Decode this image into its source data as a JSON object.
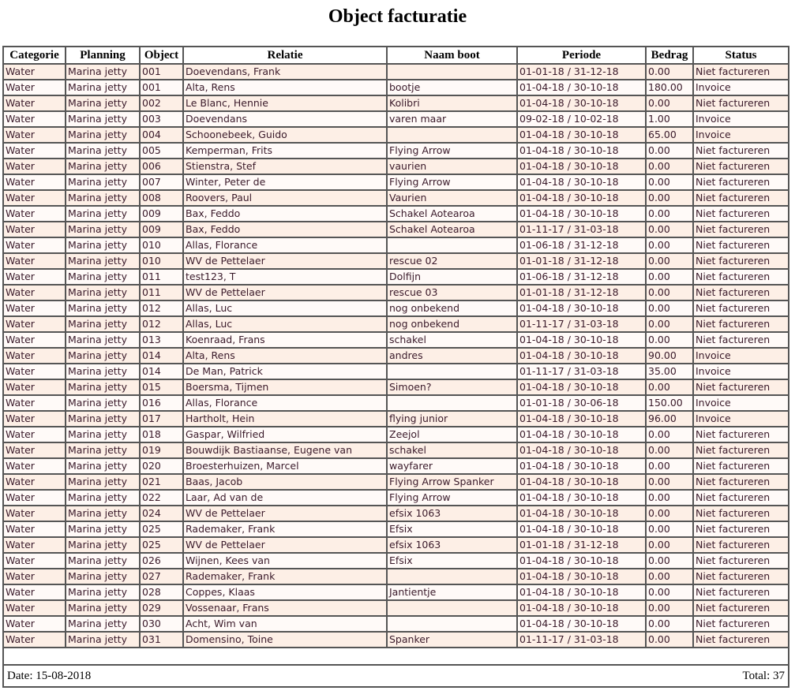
{
  "title": "Object facturatie",
  "columns": [
    "Categorie",
    "Planning",
    "Object",
    "Relatie",
    "Naam boot",
    "Periode",
    "Bedrag",
    "Status"
  ],
  "rows": [
    [
      "Water",
      "Marina jetty",
      "001",
      "Doevendans, Frank",
      "",
      "01-01-18 / 31-12-18",
      "0.00",
      "Niet factureren"
    ],
    [
      "Water",
      "Marina jetty",
      "001",
      "Alta, Rens",
      "bootje",
      "01-04-18 / 30-10-18",
      "180.00",
      "Invoice"
    ],
    [
      "Water",
      "Marina jetty",
      "002",
      "Le Blanc, Hennie",
      "Kolibri",
      "01-04-18 / 30-10-18",
      "0.00",
      "Niet factureren"
    ],
    [
      "Water",
      "Marina jetty",
      "003",
      "Doevendans",
      "varen maar",
      "09-02-18 / 10-02-18",
      "1.00",
      "Invoice"
    ],
    [
      "Water",
      "Marina jetty",
      "004",
      "Schoonebeek, Guido",
      "",
      "01-04-18 / 30-10-18",
      "65.00",
      "Invoice"
    ],
    [
      "Water",
      "Marina jetty",
      "005",
      "Kemperman, Frits",
      "Flying Arrow",
      "01-04-18 / 30-10-18",
      "0.00",
      "Niet factureren"
    ],
    [
      "Water",
      "Marina jetty",
      "006",
      "Stienstra, Stef",
      "vaurien",
      "01-04-18 / 30-10-18",
      "0.00",
      "Niet factureren"
    ],
    [
      "Water",
      "Marina jetty",
      "007",
      "Winter, Peter de",
      "Flying Arrow",
      "01-04-18 / 30-10-18",
      "0.00",
      "Niet factureren"
    ],
    [
      "Water",
      "Marina jetty",
      "008",
      "Roovers, Paul",
      "Vaurien",
      "01-04-18 / 30-10-18",
      "0.00",
      "Niet factureren"
    ],
    [
      "Water",
      "Marina jetty",
      "009",
      "Bax, Feddo",
      "Schakel Aotearoa",
      "01-04-18 / 30-10-18",
      "0.00",
      "Niet factureren"
    ],
    [
      "Water",
      "Marina jetty",
      "009",
      "Bax, Feddo",
      "Schakel Aotearoa",
      "01-11-17 / 31-03-18",
      "0.00",
      "Niet factureren"
    ],
    [
      "Water",
      "Marina jetty",
      "010",
      "Allas, Florance",
      "",
      "01-06-18 / 31-12-18",
      "0.00",
      "Niet factureren"
    ],
    [
      "Water",
      "Marina jetty",
      "010",
      "WV de Pettelaer",
      "rescue 02",
      "01-01-18 / 31-12-18",
      "0.00",
      "Niet factureren"
    ],
    [
      "Water",
      "Marina jetty",
      "011",
      "test123, T",
      "Dolfijn",
      "01-06-18 / 31-12-18",
      "0.00",
      "Niet factureren"
    ],
    [
      "Water",
      "Marina jetty",
      "011",
      "WV de Pettelaer",
      "rescue 03",
      "01-01-18 / 31-12-18",
      "0.00",
      "Niet factureren"
    ],
    [
      "Water",
      "Marina jetty",
      "012",
      "Allas, Luc",
      "nog onbekend",
      "01-04-18 / 30-10-18",
      "0.00",
      "Niet factureren"
    ],
    [
      "Water",
      "Marina jetty",
      "012",
      "Allas, Luc",
      "nog onbekend",
      "01-11-17 / 31-03-18",
      "0.00",
      "Niet factureren"
    ],
    [
      "Water",
      "Marina jetty",
      "013",
      "Koenraad, Frans",
      "schakel",
      "01-04-18 / 30-10-18",
      "0.00",
      "Niet factureren"
    ],
    [
      "Water",
      "Marina jetty",
      "014",
      "Alta, Rens",
      "andres",
      "01-04-18 / 30-10-18",
      "90.00",
      "Invoice"
    ],
    [
      "Water",
      "Marina jetty",
      "014",
      "De Man, Patrick",
      "",
      "01-11-17 / 31-03-18",
      "35.00",
      "Invoice"
    ],
    [
      "Water",
      "Marina jetty",
      "015",
      "Boersma, Tijmen",
      "Simoen?",
      "01-04-18 / 30-10-18",
      "0.00",
      "Niet factureren"
    ],
    [
      "Water",
      "Marina jetty",
      "016",
      "Allas, Florance",
      "",
      "01-01-18 / 30-06-18",
      "150.00",
      "Invoice"
    ],
    [
      "Water",
      "Marina jetty",
      "017",
      "Hartholt, Hein",
      "flying junior",
      "01-04-18 / 30-10-18",
      "96.00",
      "Invoice"
    ],
    [
      "Water",
      "Marina jetty",
      "018",
      "Gaspar, Wilfried",
      "Zeejol",
      "01-04-18 / 30-10-18",
      "0.00",
      "Niet factureren"
    ],
    [
      "Water",
      "Marina jetty",
      "019",
      "Bouwdijk Bastiaanse, Eugene van",
      "schakel",
      "01-04-18 / 30-10-18",
      "0.00",
      "Niet factureren"
    ],
    [
      "Water",
      "Marina jetty",
      "020",
      "Broesterhuizen, Marcel",
      "wayfarer",
      "01-04-18 / 30-10-18",
      "0.00",
      "Niet factureren"
    ],
    [
      "Water",
      "Marina jetty",
      "021",
      "Baas, Jacob",
      "Flying Arrow Spanker",
      "01-04-18 / 30-10-18",
      "0.00",
      "Niet factureren"
    ],
    [
      "Water",
      "Marina jetty",
      "022",
      "Laar, Ad van de",
      "Flying Arrow",
      "01-04-18 / 30-10-18",
      "0.00",
      "Niet factureren"
    ],
    [
      "Water",
      "Marina jetty",
      "024",
      "WV de Pettelaer",
      "efsix 1063",
      "01-04-18 / 30-10-18",
      "0.00",
      "Niet factureren"
    ],
    [
      "Water",
      "Marina jetty",
      "025",
      "Rademaker, Frank",
      "Efsix",
      "01-04-18 / 30-10-18",
      "0.00",
      "Niet factureren"
    ],
    [
      "Water",
      "Marina jetty",
      "025",
      "WV de Pettelaer",
      "efsix 1063",
      "01-01-18 / 31-12-18",
      "0.00",
      "Niet factureren"
    ],
    [
      "Water",
      "Marina jetty",
      "026",
      "Wijnen, Kees van",
      "Efsix",
      "01-04-18 / 30-10-18",
      "0.00",
      "Niet factureren"
    ],
    [
      "Water",
      "Marina jetty",
      "027",
      "Rademaker, Frank",
      "",
      "01-04-18 / 30-10-18",
      "0.00",
      "Niet factureren"
    ],
    [
      "Water",
      "Marina jetty",
      "028",
      "Coppes, Klaas",
      "Jantientje",
      "01-04-18 / 30-10-18",
      "0.00",
      "Niet factureren"
    ],
    [
      "Water",
      "Marina jetty",
      "029",
      "Vossenaar, Frans",
      "",
      "01-04-18 / 30-10-18",
      "0.00",
      "Niet factureren"
    ],
    [
      "Water",
      "Marina jetty",
      "030",
      "Acht, Wim van",
      "",
      "01-04-18 / 30-10-18",
      "0.00",
      "Niet factureren"
    ],
    [
      "Water",
      "Marina jetty",
      "031",
      "Domensino, Toine",
      "Spanker",
      "01-11-17 / 31-03-18",
      "0.00",
      "Niet factureren"
    ]
  ],
  "footer": {
    "date_label": "Date: 15-08-2018",
    "total_label": "Total: 37"
  },
  "colors": {
    "row_odd": "#fdefe6",
    "row_even": "#fffaf8",
    "border": "#555555",
    "cell_text": "#3a1a2a"
  }
}
